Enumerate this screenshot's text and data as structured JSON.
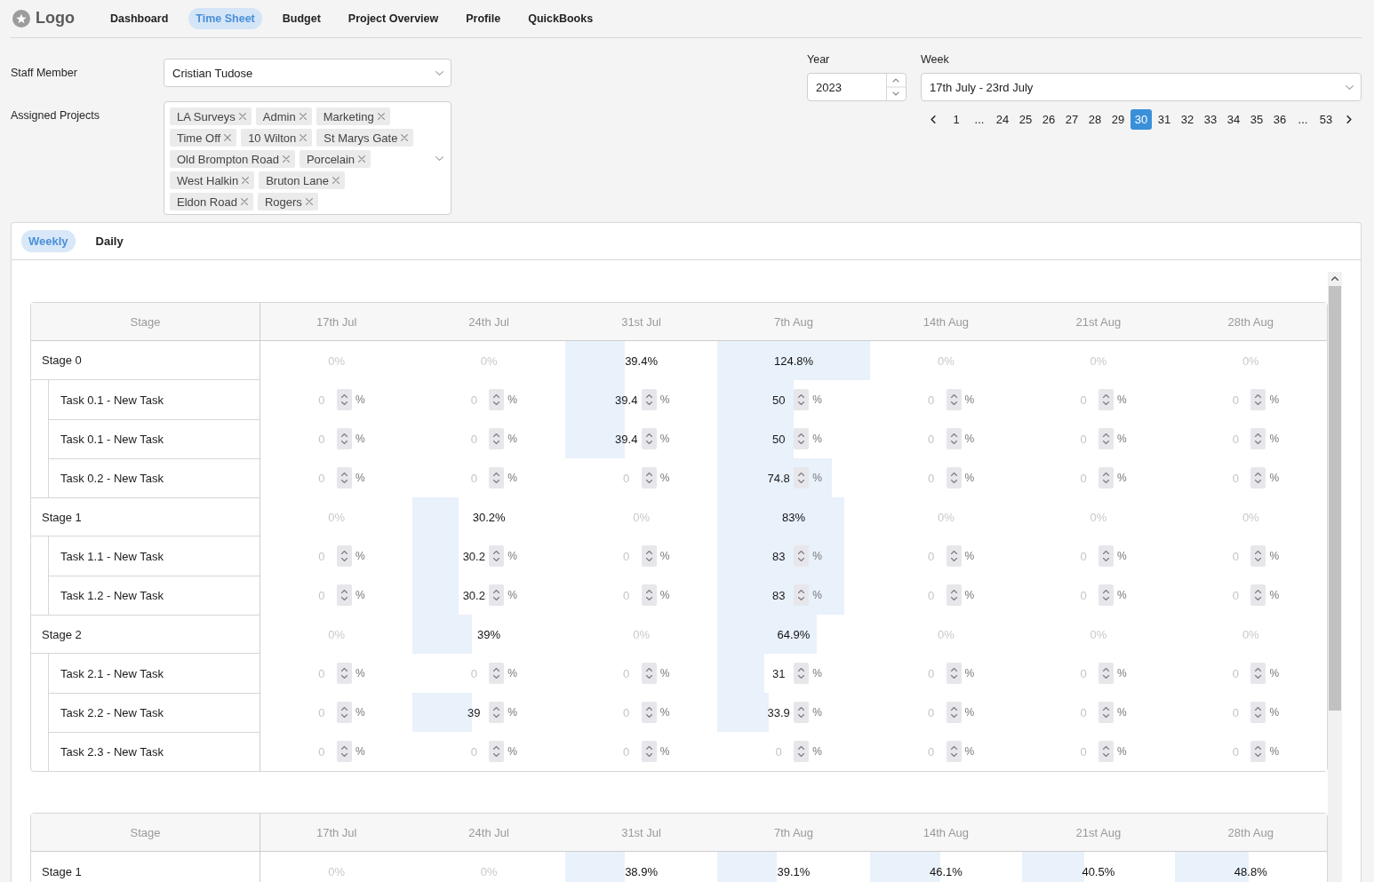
{
  "nav": {
    "logo": "Logo",
    "items": [
      {
        "label": "Dashboard",
        "selected": false
      },
      {
        "label": "Time Sheet",
        "selected": true
      },
      {
        "label": "Budget",
        "selected": false
      },
      {
        "label": "Project Overview",
        "selected": false
      },
      {
        "label": "Profile",
        "selected": false
      },
      {
        "label": "QuickBooks",
        "selected": false
      }
    ]
  },
  "staff_member": {
    "label": "Staff Member",
    "value": "Cristian Tudose"
  },
  "assigned_projects": {
    "label": "Assigned Projects",
    "tags": [
      "LA Surveys",
      "Admin",
      "Marketing",
      "Time Off",
      "10 Wilton",
      "St Marys Gate",
      "Old Brompton Road",
      "Porcelain",
      "West Halkin",
      "Bruton Lane",
      "Eldon Road",
      "Rogers"
    ]
  },
  "year": {
    "label": "Year",
    "value": "2023"
  },
  "week": {
    "label": "Week",
    "value": "17th July - 23rd July"
  },
  "pagination": [
    {
      "label": "1",
      "selected": false
    },
    {
      "label": "...",
      "selected": false
    },
    {
      "label": "24",
      "selected": false
    },
    {
      "label": "25",
      "selected": false
    },
    {
      "label": "26",
      "selected": false
    },
    {
      "label": "27",
      "selected": false
    },
    {
      "label": "28",
      "selected": false
    },
    {
      "label": "29",
      "selected": false
    },
    {
      "label": "30",
      "selected": true
    },
    {
      "label": "31",
      "selected": false
    },
    {
      "label": "32",
      "selected": false
    },
    {
      "label": "33",
      "selected": false
    },
    {
      "label": "34",
      "selected": false
    },
    {
      "label": "35",
      "selected": false
    },
    {
      "label": "36",
      "selected": false
    },
    {
      "label": "...",
      "selected": false
    },
    {
      "label": "53",
      "selected": false
    }
  ],
  "view_tabs": [
    {
      "label": "Weekly",
      "selected": true
    },
    {
      "label": "Daily",
      "selected": false
    }
  ],
  "tables": [
    {
      "stage_header": "Stage",
      "columns": [
        "17th Jul",
        "24th Jul",
        "31st Jul",
        "7th Aug",
        "14th Aug",
        "21st Aug",
        "28th Aug"
      ],
      "rows": [
        {
          "kind": "stage",
          "label": "Stage 0",
          "cells": [
            {
              "text": "0%",
              "empty": true
            },
            {
              "text": "0%",
              "empty": true
            },
            {
              "text": "39.4%",
              "empty": false,
              "level": 0.394
            },
            {
              "text": "124.8%",
              "empty": false,
              "level": 1
            },
            {
              "text": "0%",
              "empty": true
            },
            {
              "text": "0%",
              "empty": true
            },
            {
              "text": "0%",
              "empty": true
            }
          ]
        },
        {
          "kind": "task",
          "label": "Task 0.1 - New Task",
          "cells": [
            {
              "placeholder": "0",
              "unit": "%"
            },
            {
              "placeholder": "0",
              "unit": "%"
            },
            {
              "value": "39.4",
              "unit": "%",
              "level": 0.394
            },
            {
              "value": "50",
              "unit": "%",
              "level": 0.5
            },
            {
              "placeholder": "0",
              "unit": "%"
            },
            {
              "placeholder": "0",
              "unit": "%"
            },
            {
              "placeholder": "0",
              "unit": "%"
            }
          ]
        },
        {
          "kind": "task",
          "label": "Task 0.1 - New Task",
          "cells": [
            {
              "placeholder": "0",
              "unit": "%"
            },
            {
              "placeholder": "0",
              "unit": "%"
            },
            {
              "value": "39.4",
              "unit": "%",
              "level": 0.394
            },
            {
              "value": "50",
              "unit": "%",
              "level": 0.5
            },
            {
              "placeholder": "0",
              "unit": "%"
            },
            {
              "placeholder": "0",
              "unit": "%"
            },
            {
              "placeholder": "0",
              "unit": "%"
            }
          ]
        },
        {
          "kind": "task",
          "label": "Task 0.2 - New Task",
          "cells": [
            {
              "placeholder": "0",
              "unit": "%"
            },
            {
              "placeholder": "0",
              "unit": "%"
            },
            {
              "placeholder": "0",
              "unit": "%"
            },
            {
              "value": "74.8",
              "unit": "%",
              "level": 0.748
            },
            {
              "placeholder": "0",
              "unit": "%"
            },
            {
              "placeholder": "0",
              "unit": "%"
            },
            {
              "placeholder": "0",
              "unit": "%"
            }
          ]
        },
        {
          "kind": "stage",
          "label": "Stage 1",
          "cells": [
            {
              "text": "0%",
              "empty": true
            },
            {
              "text": "30.2%",
              "empty": false,
              "level": 0.302
            },
            {
              "text": "0%",
              "empty": true
            },
            {
              "text": "83%",
              "empty": false,
              "level": 0.83
            },
            {
              "text": "0%",
              "empty": true
            },
            {
              "text": "0%",
              "empty": true
            },
            {
              "text": "0%",
              "empty": true
            }
          ]
        },
        {
          "kind": "task",
          "label": "Task 1.1 - New Task",
          "cells": [
            {
              "placeholder": "0",
              "unit": "%"
            },
            {
              "value": "30.2",
              "unit": "%",
              "level": 0.302
            },
            {
              "placeholder": "0",
              "unit": "%"
            },
            {
              "value": "83",
              "unit": "%",
              "level": 0.83
            },
            {
              "placeholder": "0",
              "unit": "%"
            },
            {
              "placeholder": "0",
              "unit": "%"
            },
            {
              "placeholder": "0",
              "unit": "%"
            }
          ]
        },
        {
          "kind": "task",
          "label": "Task 1.2 - New Task",
          "cells": [
            {
              "placeholder": "0",
              "unit": "%"
            },
            {
              "value": "30.2",
              "unit": "%",
              "level": 0.302
            },
            {
              "placeholder": "0",
              "unit": "%"
            },
            {
              "value": "83",
              "unit": "%",
              "level": 0.83
            },
            {
              "placeholder": "0",
              "unit": "%"
            },
            {
              "placeholder": "0",
              "unit": "%"
            },
            {
              "placeholder": "0",
              "unit": "%"
            }
          ]
        },
        {
          "kind": "stage",
          "label": "Stage 2",
          "cells": [
            {
              "text": "0%",
              "empty": true
            },
            {
              "text": "39%",
              "empty": false,
              "level": 0.39
            },
            {
              "text": "0%",
              "empty": true
            },
            {
              "text": "64.9%",
              "empty": false,
              "level": 0.649
            },
            {
              "text": "0%",
              "empty": true
            },
            {
              "text": "0%",
              "empty": true
            },
            {
              "text": "0%",
              "empty": true
            }
          ]
        },
        {
          "kind": "task",
          "label": "Task 2.1 - New Task",
          "cells": [
            {
              "placeholder": "0",
              "unit": "%"
            },
            {
              "placeholder": "0",
              "unit": "%"
            },
            {
              "placeholder": "0",
              "unit": "%"
            },
            {
              "value": "31",
              "unit": "%",
              "level": 0.31
            },
            {
              "placeholder": "0",
              "unit": "%"
            },
            {
              "placeholder": "0",
              "unit": "%"
            },
            {
              "placeholder": "0",
              "unit": "%"
            }
          ]
        },
        {
          "kind": "task",
          "label": "Task 2.2 - New Task",
          "cells": [
            {
              "placeholder": "0",
              "unit": "%"
            },
            {
              "value": "39",
              "unit": "%",
              "level": 0.39
            },
            {
              "placeholder": "0",
              "unit": "%"
            },
            {
              "value": "33.9",
              "unit": "%",
              "level": 0.339
            },
            {
              "placeholder": "0",
              "unit": "%"
            },
            {
              "placeholder": "0",
              "unit": "%"
            },
            {
              "placeholder": "0",
              "unit": "%"
            }
          ]
        },
        {
          "kind": "task",
          "label": "Task 2.3 - New Task",
          "cells": [
            {
              "placeholder": "0",
              "unit": "%"
            },
            {
              "placeholder": "0",
              "unit": "%"
            },
            {
              "placeholder": "0",
              "unit": "%"
            },
            {
              "placeholder": "0",
              "unit": "%"
            },
            {
              "placeholder": "0",
              "unit": "%"
            },
            {
              "placeholder": "0",
              "unit": "%"
            },
            {
              "placeholder": "0",
              "unit": "%"
            }
          ]
        }
      ]
    },
    {
      "stage_header": "Stage",
      "columns": [
        "17th Jul",
        "24th Jul",
        "31st Jul",
        "7th Aug",
        "14th Aug",
        "21st Aug",
        "28th Aug"
      ],
      "rows": [
        {
          "kind": "stage",
          "label": "Stage 1",
          "cells": [
            {
              "text": "0%",
              "empty": true
            },
            {
              "text": "0%",
              "empty": true
            },
            {
              "text": "38.9%",
              "empty": false,
              "level": 0.389
            },
            {
              "text": "39.1%",
              "empty": false,
              "level": 0.391
            },
            {
              "text": "46.1%",
              "empty": false,
              "level": 0.461
            },
            {
              "text": "40.5%",
              "empty": false,
              "level": 0.405
            },
            {
              "text": "48.8%",
              "empty": false,
              "level": 0.488
            }
          ]
        }
      ]
    }
  ]
}
